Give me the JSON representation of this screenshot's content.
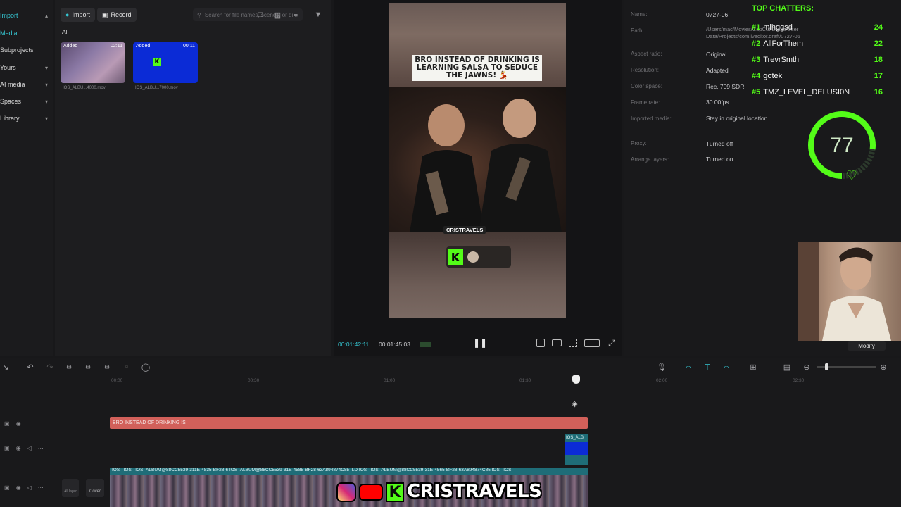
{
  "nav": {
    "items": [
      {
        "label": "Import",
        "active": true,
        "chev": "▴"
      },
      {
        "label": "Media",
        "active": true,
        "chev": ""
      },
      {
        "label": "Subprojects",
        "active": false,
        "chev": ""
      },
      {
        "label": "Yours",
        "active": false,
        "chev": "▾"
      },
      {
        "label": "AI media",
        "active": false,
        "chev": "▾"
      },
      {
        "label": "Spaces",
        "active": false,
        "chev": "▾"
      },
      {
        "label": "Library",
        "active": false,
        "chev": "▾"
      }
    ]
  },
  "media": {
    "import_label": "Import",
    "record_label": "Record",
    "search_placeholder": "Search for file names, scenes, or di...",
    "filter_all": "All",
    "clips": [
      {
        "tag": "Added",
        "duration": "02:11",
        "name": "IOS_ALBU...4000.mov"
      },
      {
        "tag": "Added",
        "duration": "00:11",
        "name": "IOS_ALBU...7000.mov"
      }
    ]
  },
  "player": {
    "caption": "BRO INSTEAD OF DRINKING IS LEARNING SALSA TO SEDUCE THE JAWNS! 💃",
    "tagline": "CRISTRAVELS",
    "current_time": "00:01:42:11",
    "total_time": "00:01:45:03",
    "ratio_label": "Ratio"
  },
  "props": {
    "rows": [
      {
        "label": "Name:",
        "value": "0727-06"
      },
      {
        "label": "Path:",
        "value": "/Users/mac/Movies/CapCut Drafts/User Data/Projects/com.lveditor.draft/0727-06"
      },
      {
        "label": "Aspect ratio:",
        "value": "Original"
      },
      {
        "label": "Resolution:",
        "value": "Adapted"
      },
      {
        "label": "Color space:",
        "value": "Rec. 709 SDR"
      },
      {
        "label": "Frame rate:",
        "value": "30.00fps"
      },
      {
        "label": "Imported media:",
        "value": "Stay in original location"
      },
      {
        "label": "Proxy:",
        "value": "Turned off"
      },
      {
        "label": "Arrange layers:",
        "value": "Turned on"
      }
    ],
    "modify_label": "Modify"
  },
  "chat": {
    "title": "TOP CHATTERS:",
    "entries": [
      {
        "rank": "#1",
        "name": "mihggsd",
        "count": "24"
      },
      {
        "rank": "#2",
        "name": "AllForThem",
        "count": "22"
      },
      {
        "rank": "#3",
        "name": "TrevrSmth",
        "count": "18"
      },
      {
        "rank": "#4",
        "name": "gotek",
        "count": "17"
      },
      {
        "rank": "#5",
        "name": "TMZ_LEVEL_DELUSI0N",
        "count": "16"
      }
    ],
    "gauge_value": "77",
    "gauge_level": 0.77
  },
  "timeline": {
    "ticks": [
      "00:00",
      "00:30",
      "01:00",
      "01:30",
      "02:00",
      "02:30"
    ],
    "text_clip_label": "BRO INSTEAD OF DRINKING IS",
    "overlay_clip_label": "IOS_ALB",
    "main_clip_label": "IOS_  IOS_  IOS_ALBUM@88CC5539-311E-4835-BF28-6  IOS_ALBUM@88CC5539-31E-4585-BF28-63A894874C85_LD  IOS_  IOS_ALBUM@88CC5539-31E-4565-BF28-63A894874C85  IOS_  IOS_",
    "cover_label": "Cover",
    "all_layer_label": "All layer"
  },
  "banner": {
    "channel": "CRISTRAVELS"
  },
  "colors": {
    "accent": "#35c6d2",
    "kick": "#53fc18",
    "text_clip": "#d2605a",
    "main_clip": "#1f6d78"
  }
}
